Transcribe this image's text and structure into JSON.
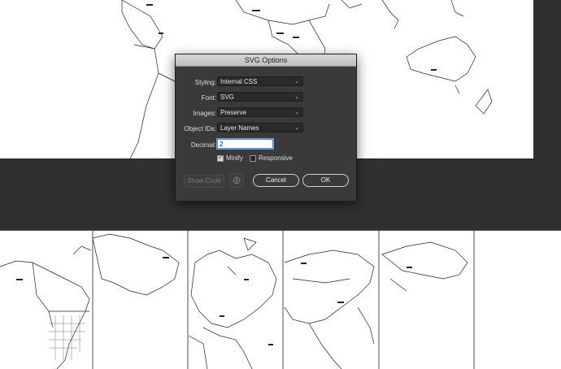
{
  "dialog": {
    "title": "SVG Options",
    "fields": {
      "styling": {
        "label": "Styling:",
        "value": "Internal CSS"
      },
      "font": {
        "label": "Font:",
        "value": "SVG"
      },
      "images": {
        "label": "Images:",
        "value": "Preserve"
      },
      "object_ids": {
        "label": "Object IDs:",
        "value": "Layer Names"
      },
      "decimal": {
        "label": "Decimal:",
        "value": "2"
      }
    },
    "checkboxes": {
      "minify": {
        "label": "Minify",
        "checked": true
      },
      "responsive": {
        "label": "Responsive",
        "checked": false
      }
    },
    "buttons": {
      "show_code": "Show Code",
      "cancel": "Cancel",
      "ok": "OK"
    }
  },
  "icons": {
    "dropdown": "chevron-down-icon",
    "web": "globe-icon"
  },
  "colors": {
    "canvas_bg": "#303030",
    "artboard": "#ffffff",
    "dialog_bg": "#3a3a3a",
    "focus_ring": "#4a8fe0"
  }
}
